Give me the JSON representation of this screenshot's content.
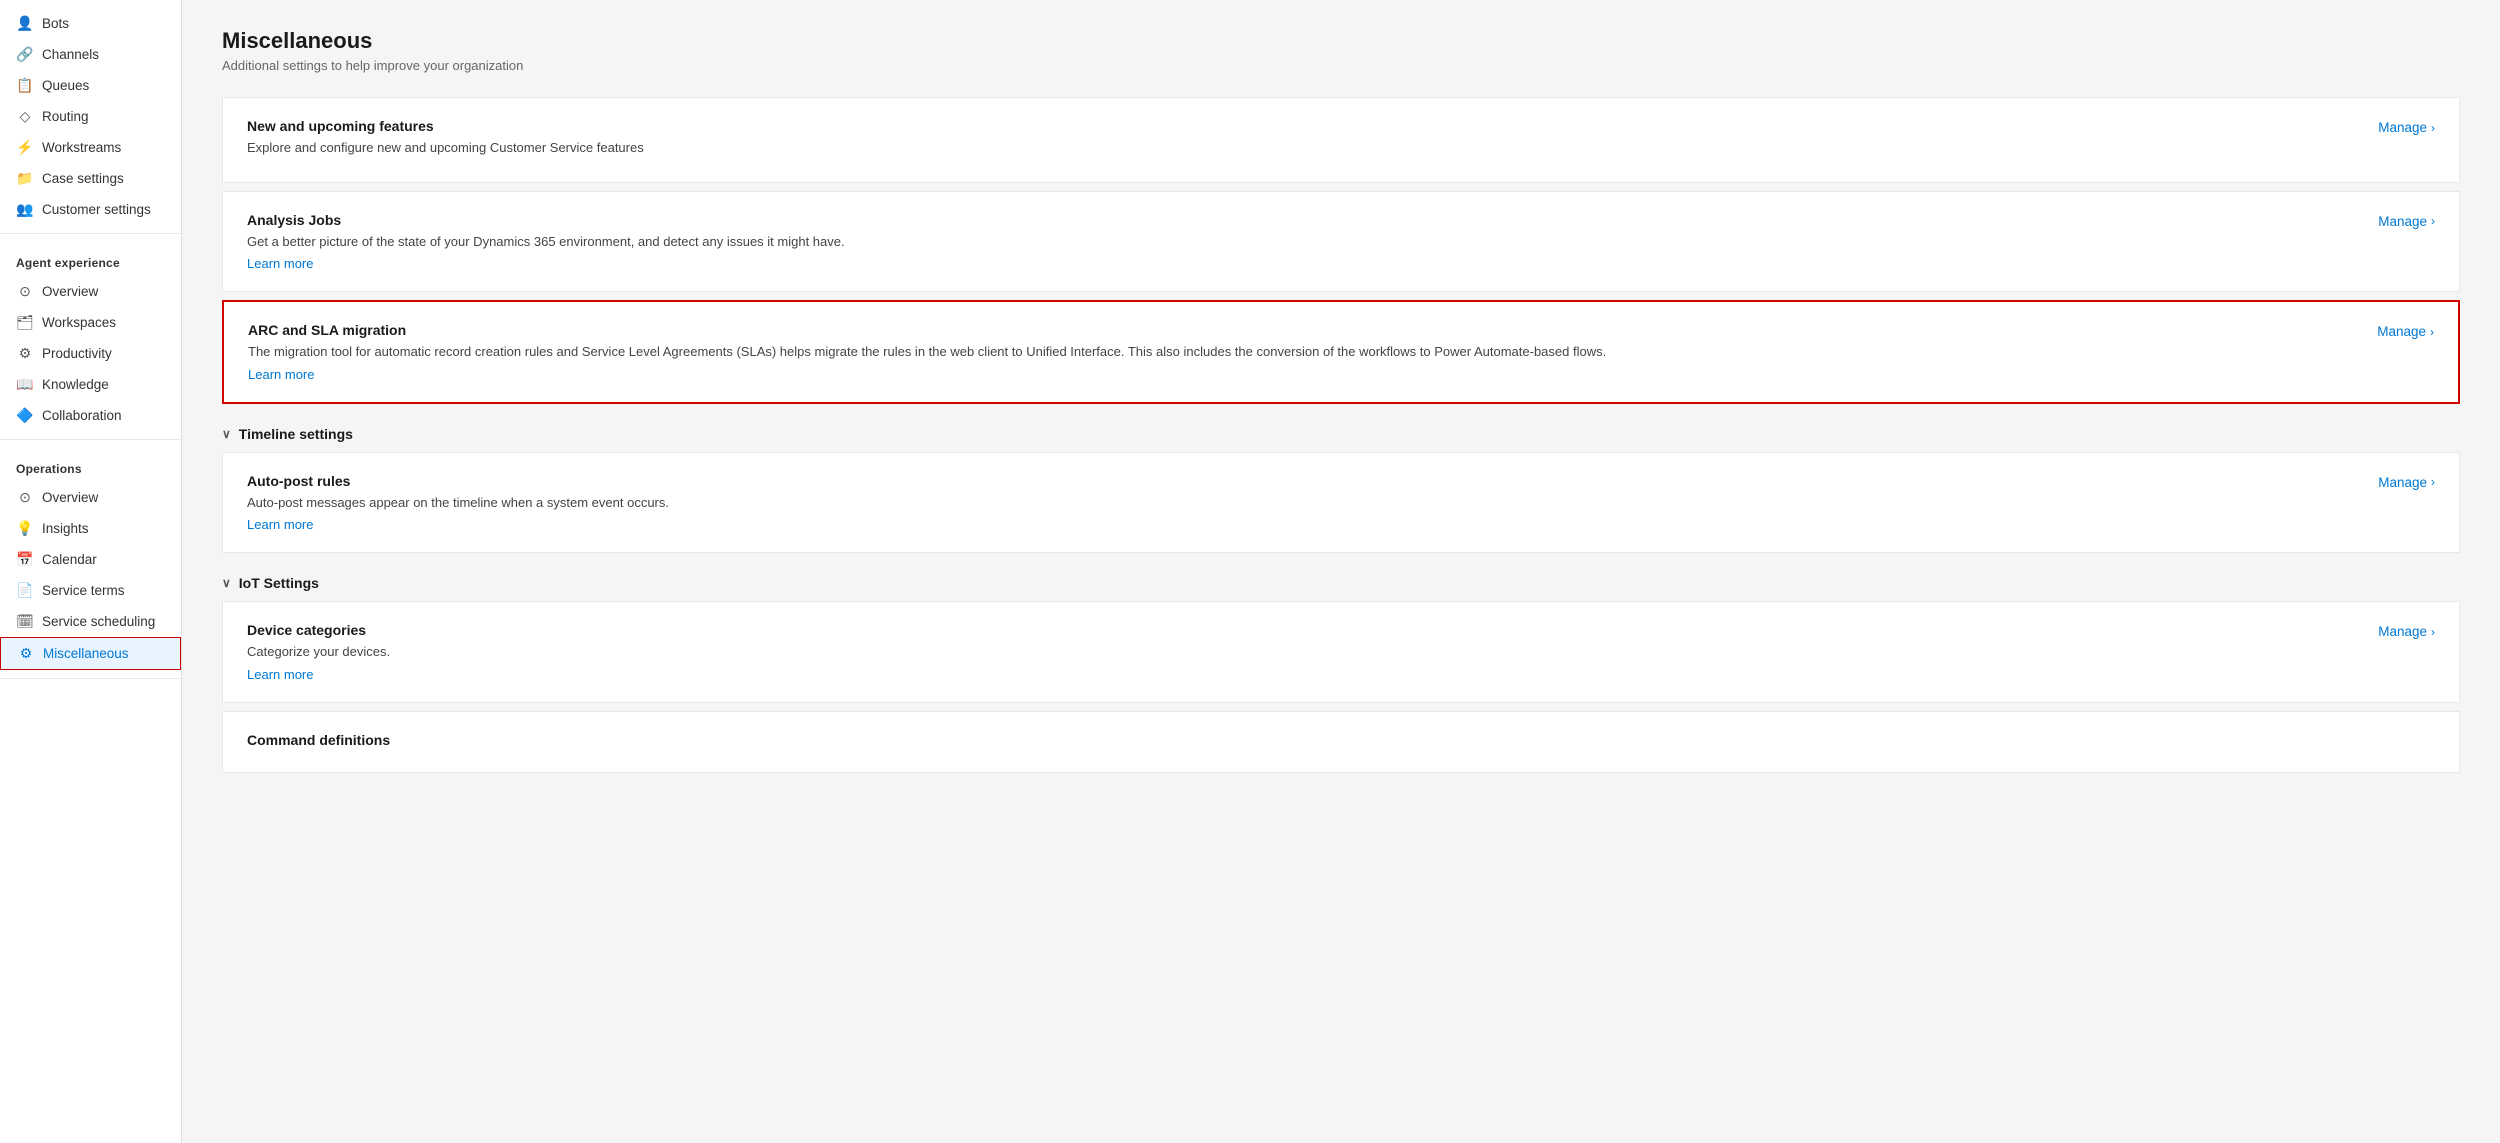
{
  "sidebar": {
    "sections": [
      {
        "name": "",
        "items": [
          {
            "id": "bots",
            "label": "Bots",
            "icon": "👤"
          },
          {
            "id": "channels",
            "label": "Channels",
            "icon": "🔗"
          },
          {
            "id": "queues",
            "label": "Queues",
            "icon": "📋"
          },
          {
            "id": "routing",
            "label": "Routing",
            "icon": "◇"
          },
          {
            "id": "workstreams",
            "label": "Workstreams",
            "icon": "⚡"
          },
          {
            "id": "case-settings",
            "label": "Case settings",
            "icon": "📁"
          },
          {
            "id": "customer-settings",
            "label": "Customer settings",
            "icon": "👥"
          }
        ]
      },
      {
        "name": "Agent experience",
        "items": [
          {
            "id": "ae-overview",
            "label": "Overview",
            "icon": "⊙"
          },
          {
            "id": "workspaces",
            "label": "Workspaces",
            "icon": "🗂"
          },
          {
            "id": "productivity",
            "label": "Productivity",
            "icon": "⚙"
          },
          {
            "id": "knowledge",
            "label": "Knowledge",
            "icon": "📖"
          },
          {
            "id": "collaboration",
            "label": "Collaboration",
            "icon": "🔷"
          }
        ]
      },
      {
        "name": "Operations",
        "items": [
          {
            "id": "ops-overview",
            "label": "Overview",
            "icon": "⊙"
          },
          {
            "id": "insights",
            "label": "Insights",
            "icon": "💡"
          },
          {
            "id": "calendar",
            "label": "Calendar",
            "icon": "📅"
          },
          {
            "id": "service-terms",
            "label": "Service terms",
            "icon": "📄"
          },
          {
            "id": "service-scheduling",
            "label": "Service scheduling",
            "icon": "🗓"
          },
          {
            "id": "miscellaneous",
            "label": "Miscellaneous",
            "icon": "⚙",
            "active": true
          }
        ]
      }
    ]
  },
  "main": {
    "title": "Miscellaneous",
    "subtitle": "Additional settings to help improve your organization",
    "cards": [
      {
        "id": "new-features",
        "title": "New and upcoming features",
        "desc": "Explore and configure new and upcoming Customer Service features",
        "link": null,
        "manage": "Manage",
        "highlighted": false
      },
      {
        "id": "analysis-jobs",
        "title": "Analysis Jobs",
        "desc": "Get a better picture of the state of your Dynamics 365 environment, and detect any issues it might have.",
        "link": "Learn more",
        "manage": "Manage",
        "highlighted": false
      },
      {
        "id": "arc-sla-migration",
        "title": "ARC and SLA migration",
        "desc": "The migration tool for automatic record creation rules and Service Level Agreements (SLAs) helps migrate the rules in the web client to Unified Interface. This also includes the conversion of the workflows to Power Automate-based flows.",
        "link": "Learn more",
        "manage": "Manage",
        "highlighted": true
      }
    ],
    "sections": [
      {
        "id": "timeline-settings",
        "title": "Timeline settings",
        "collapsed": false,
        "cards": [
          {
            "id": "auto-post-rules",
            "title": "Auto-post rules",
            "desc": "Auto-post messages appear on the timeline when a system event occurs.",
            "link": "Learn more",
            "manage": "Manage",
            "highlighted": false
          }
        ]
      },
      {
        "id": "iot-settings",
        "title": "IoT Settings",
        "collapsed": false,
        "cards": [
          {
            "id": "device-categories",
            "title": "Device categories",
            "desc": "Categorize your devices.",
            "link": "Learn more",
            "manage": "Manage",
            "highlighted": false
          },
          {
            "id": "command-definitions",
            "title": "Command definitions",
            "desc": "",
            "link": null,
            "manage": null,
            "highlighted": false
          }
        ]
      }
    ]
  }
}
